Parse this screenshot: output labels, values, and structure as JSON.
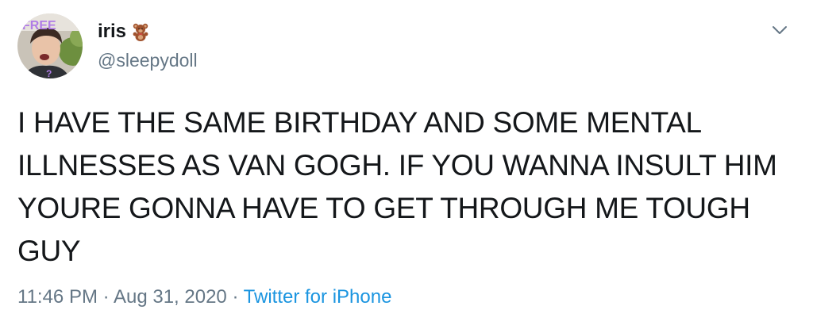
{
  "user": {
    "display_name": "iris",
    "name_emoji": "teddy-bear-emoji",
    "handle": "@sleepydoll",
    "avatar_overlay_text": "FREE"
  },
  "tweet": {
    "text": "I HAVE THE SAME BIRTHDAY AND SOME MENTAL\nILLNESSES AS VAN GOGH. IF YOU WANNA INSULT HIM\nYOURE GONNA HAVE TO GET THROUGH ME TOUGH\nGUY",
    "time": "11:46 PM",
    "separator": "·",
    "date": "Aug 31, 2020",
    "source": "Twitter for iPhone"
  },
  "colors": {
    "text_primary": "#14171a",
    "text_secondary": "#657786",
    "link": "#1b95e0",
    "caret": "#657786"
  },
  "icons": {
    "menu": "chevron-down-icon"
  }
}
